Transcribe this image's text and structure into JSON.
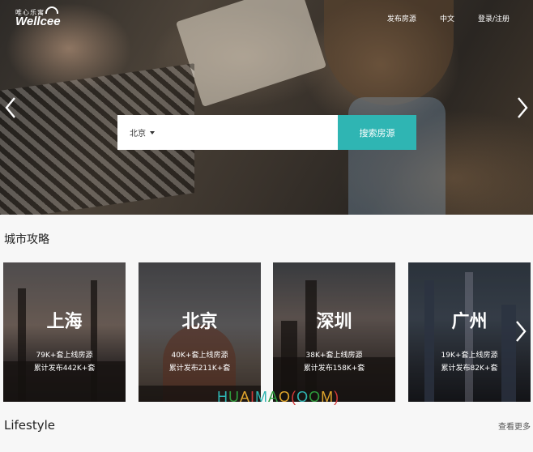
{
  "brand": {
    "tagline": "唯心乐寓",
    "name": "Wellcee"
  },
  "nav": {
    "items": [
      "发布房源",
      "中文",
      "登录/注册"
    ]
  },
  "search": {
    "city": "北京",
    "placeholder": "",
    "button_label": "搜索房源"
  },
  "colors": {
    "accent": "#2fb5b3",
    "watermark": [
      "#2fb5b3",
      "#2e9c3c",
      "#e0a52c",
      "#d23a3a"
    ]
  },
  "sections": {
    "city_guide_title": "城市攻略",
    "lifestyle_title": "Lifestyle",
    "more_label": "查看更多"
  },
  "cities": [
    {
      "name": "上海",
      "online": "79K+套上线房源",
      "published": "累计发布442K+套"
    },
    {
      "name": "北京",
      "online": "40K+套上线房源",
      "published": "累计发布211K+套"
    },
    {
      "name": "深圳",
      "online": "38K+套上线房源",
      "published": "累计发布158K+套"
    },
    {
      "name": "广州",
      "online": "19K+套上线房源",
      "published": "累计发布82K+套"
    }
  ],
  "watermark_text": "HUAIMAO(OOM)"
}
